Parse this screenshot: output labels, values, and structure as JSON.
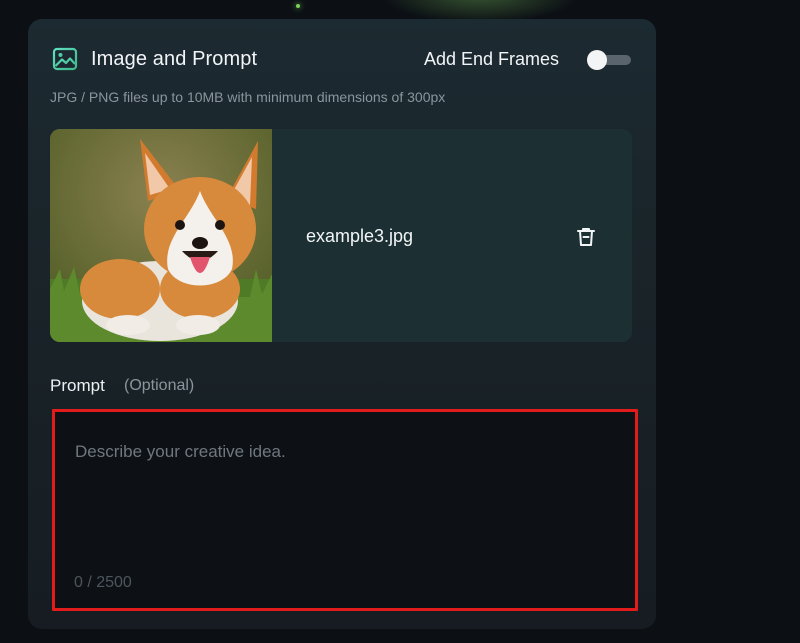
{
  "header": {
    "title": "Image and Prompt",
    "icon": "image-icon",
    "accent": "#4fd0a8"
  },
  "end_frames": {
    "label": "Add End Frames",
    "enabled": false
  },
  "subtitle": "JPG / PNG files up to 10MB with minimum dimensions of 300px",
  "upload": {
    "file_name": "example3.jpg",
    "delete_icon": "trash-icon"
  },
  "prompt": {
    "label": "Prompt",
    "optional": "(Optional)",
    "placeholder": "Describe your creative idea.",
    "value": "",
    "counter": "0 / 2500",
    "highlight_color": "#e21b1b"
  }
}
